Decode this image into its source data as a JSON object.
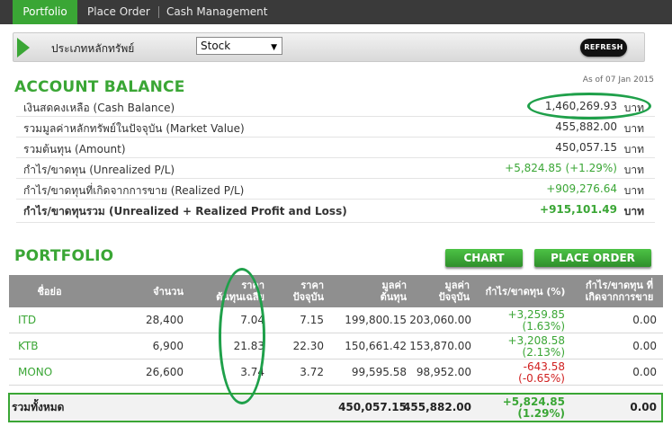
{
  "tabs": [
    {
      "label": "Portfolio",
      "active": true
    },
    {
      "label": "Place Order",
      "active": false
    },
    {
      "label": "Cash Management",
      "active": false
    }
  ],
  "filter": {
    "label": "ประเภทหลักทรัพย์",
    "selected": "Stock"
  },
  "refresh_label": "REFRESH",
  "as_of": "As of 07 Jan 2015",
  "account_balance": {
    "title": "ACCOUNT BALANCE",
    "rows": [
      {
        "label": "เงินสดคงเหลือ (Cash Balance)",
        "value": "1,460,269.93",
        "unit": "บาท"
      },
      {
        "label": "รวมมูลค่าหลักทรัพย์ในปัจจุบัน (Market Value)",
        "value": "455,882.00",
        "unit": "บาท"
      },
      {
        "label": "รวมต้นทุน (Amount)",
        "value": "450,057.15",
        "unit": "บาท"
      },
      {
        "label": "กำไร/ขาดทุน (Unrealized P/L)",
        "value": "+5,824.85 (+1.29%)",
        "unit": "บาท"
      },
      {
        "label": "กำไร/ขาดทุนที่เกิดจากการขาย (Realized P/L)",
        "value": "+909,276.64",
        "unit": "บาท"
      },
      {
        "label": "กำไร/ขาดทุนรวม (Unrealized + Realized Profit and Loss)",
        "value": "+915,101.49",
        "unit": "บาท"
      }
    ]
  },
  "portfolio": {
    "title": "PORTFOLIO",
    "chart_button": "CHART",
    "place_order_button": "PLACE ORDER",
    "headers": {
      "symbol": "ชื่อย่อ",
      "volume": "จำนวน",
      "avg_cost": "ราคา\nต้นทุนเฉลี่ย",
      "last": "ราคา\nปัจจุบัน",
      "cost": "มูลค่า\nต้นทุน",
      "market": "มูลค่า\nปัจจุบัน",
      "unrealized": "กำไร/ขาดทุน (%)",
      "realized": "กำไร/ขาดทุน ที่\nเกิดจากการขาย"
    },
    "rows": [
      {
        "symbol": "ITD",
        "volume": "28,400",
        "avg_cost": "7.04",
        "last": "7.15",
        "cost": "199,800.15",
        "market": "203,060.00",
        "pl": "+3,259.85",
        "pl_pct": "(1.63%)",
        "realized": "0.00"
      },
      {
        "symbol": "KTB",
        "volume": "6,900",
        "avg_cost": "21.83",
        "last": "22.30",
        "cost": "150,661.42",
        "market": "153,870.00",
        "pl": "+3,208.58",
        "pl_pct": "(2.13%)",
        "realized": "0.00"
      },
      {
        "symbol": "MONO",
        "volume": "26,600",
        "avg_cost": "3.74",
        "last": "3.72",
        "cost": "99,595.58",
        "market": "98,952.00",
        "pl": "-643.58",
        "pl_pct": "(-0.65%)",
        "realized": "0.00"
      }
    ],
    "total": {
      "label": "รวมทั้งหมด",
      "cost": "450,057.15",
      "market": "455,882.00",
      "pl": "+5,824.85",
      "pl_pct": "(1.29%)",
      "realized": "0.00"
    }
  },
  "colors": {
    "accent": "#3aa635",
    "highlight_oval": "#1fa04a",
    "negative": "#d01f1f",
    "tabbar": "#3a3a3a",
    "table_header": "#8f8f8f"
  }
}
